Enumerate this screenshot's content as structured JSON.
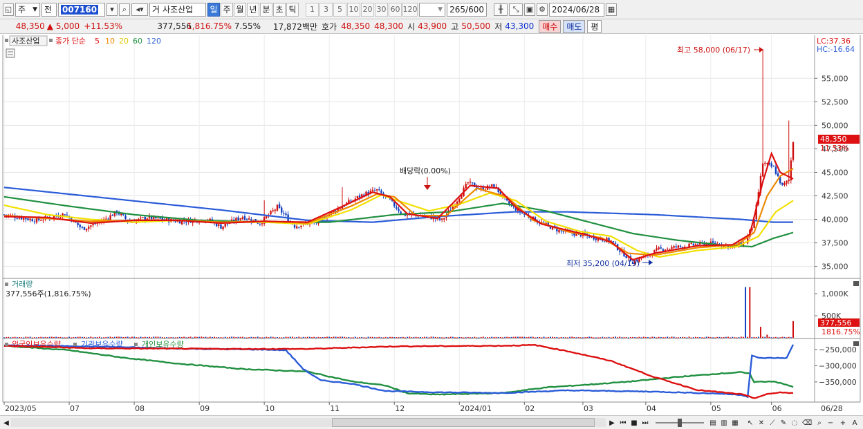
{
  "toolbar": {
    "market": "주",
    "prev_label": "전",
    "code": "007160",
    "name_prefix": "거",
    "stock_name": "사조산업",
    "periods": [
      "일",
      "주",
      "월",
      "년",
      "분",
      "초",
      "틱"
    ],
    "active_period": "일",
    "numbers": [
      "1",
      "3",
      "5",
      "10",
      "20",
      "30",
      "60",
      "120"
    ],
    "count_value": "265",
    "count_total": "/600",
    "date": "2024/06/28"
  },
  "quote": {
    "price": "48,350",
    "change_arrow": "▲",
    "change": "5,000",
    "change_pct": "+11.53%",
    "volume": "377,556",
    "volume_ratio": "1,816.75%",
    "turnover": "7.55%",
    "amount": "17,872백만",
    "hoga_label": "호가",
    "ask": "48,350",
    "bid": "48,300",
    "open_label": "시",
    "open": "43,900",
    "high_label": "고",
    "high": "50,500",
    "low_label": "저",
    "low": "43,300",
    "buy_label": "매수",
    "sell_label": "매도",
    "eval_label": "평"
  },
  "legend": {
    "stock_name": "사조산업",
    "ma_label": "종가 단순",
    "periods": [
      "5",
      "10",
      "20",
      "60",
      "120"
    ]
  },
  "lc_label": "LC:37.36",
  "hc_label": "HC:-16.64",
  "annotations": {
    "high": "최고 58,000 (06/17)",
    "low": "최저 35,200 (04/19)",
    "dividend": "배당락(0.00%)"
  },
  "price_badge": {
    "value": "48,350",
    "pct": "11.53%"
  },
  "volume_panel": {
    "title": "거래량",
    "value_text": "377,556주(1,816.75%)",
    "badge_value": "377,556",
    "badge_pct": "1816.75%"
  },
  "holdings_panel": {
    "legend": [
      "외국인보유수량",
      "기관보유수량",
      "개인보유수량"
    ]
  },
  "colors": {
    "up": "#d01010",
    "down": "#1040c0",
    "ma5": "#dd1111",
    "ma10": "#ee8800",
    "ma20": "#f2e000",
    "ma60": "#209040",
    "ma120": "#2a5cd8",
    "foreign": "#dd1111",
    "institution": "#2a5cd8",
    "individual": "#209040"
  },
  "chart_data": {
    "type": "candlestick",
    "price_axis": {
      "ticks": [
        55000,
        52500,
        50000,
        47500,
        45000,
        42500,
        40000,
        37500,
        35000
      ],
      "ylim": [
        33800,
        59500
      ]
    },
    "volume_axis": {
      "ticks": [
        1000000,
        500000
      ],
      "unit": "K",
      "ylim": [
        0,
        1300000
      ]
    },
    "holdings_axis": {
      "ticks": [
        -250000,
        -300000,
        -350000
      ],
      "ylim": [
        -410000,
        -220000
      ]
    },
    "x_ticks": [
      "2023/05",
      "07",
      "08",
      "09",
      "10",
      "11",
      "12",
      "2024/01",
      "02",
      "03",
      "04",
      "05",
      "06",
      "06/28"
    ],
    "price_key": [
      [
        0,
        40500
      ],
      [
        15,
        39900
      ],
      [
        28,
        40600
      ],
      [
        36,
        39000
      ],
      [
        45,
        39800
      ],
      [
        52,
        40800
      ],
      [
        58,
        39700
      ],
      [
        66,
        40200
      ],
      [
        80,
        39800
      ],
      [
        94,
        40000
      ],
      [
        100,
        39200
      ],
      [
        110,
        40300
      ],
      [
        118,
        39600
      ],
      [
        126,
        41300
      ],
      [
        134,
        39300
      ],
      [
        144,
        39700
      ],
      [
        150,
        40600
      ],
      [
        158,
        41700
      ],
      [
        166,
        42700
      ],
      [
        172,
        43100
      ],
      [
        178,
        42000
      ],
      [
        184,
        40500
      ],
      [
        194,
        40400
      ],
      [
        202,
        39900
      ],
      [
        208,
        41700
      ],
      [
        214,
        43900
      ],
      [
        220,
        43200
      ],
      [
        226,
        43600
      ],
      [
        232,
        41800
      ],
      [
        238,
        40800
      ],
      [
        246,
        39800
      ],
      [
        256,
        38800
      ],
      [
        268,
        38300
      ],
      [
        280,
        37700
      ],
      [
        284,
        36700
      ],
      [
        290,
        35500
      ],
      [
        296,
        36100
      ],
      [
        302,
        36800
      ],
      [
        312,
        37100
      ],
      [
        322,
        37400
      ],
      [
        330,
        37400
      ],
      [
        336,
        37100
      ],
      [
        342,
        37600
      ],
      [
        346,
        39800
      ],
      [
        350,
        46000
      ],
      [
        355,
        45500
      ],
      [
        359,
        43500
      ],
      [
        362,
        44200
      ],
      [
        364,
        48350
      ]
    ],
    "ma_key": {
      "ma5": [
        [
          0,
          40300
        ],
        [
          20,
          40200
        ],
        [
          40,
          39600
        ],
        [
          60,
          39900
        ],
        [
          80,
          39900
        ],
        [
          100,
          39600
        ],
        [
          120,
          39800
        ],
        [
          140,
          39700
        ],
        [
          160,
          41800
        ],
        [
          170,
          42900
        ],
        [
          178,
          42400
        ],
        [
          186,
          40600
        ],
        [
          200,
          40100
        ],
        [
          215,
          43600
        ],
        [
          228,
          43300
        ],
        [
          236,
          41300
        ],
        [
          248,
          39500
        ],
        [
          268,
          38400
        ],
        [
          280,
          37600
        ],
        [
          290,
          35700
        ],
        [
          300,
          36400
        ],
        [
          320,
          37200
        ],
        [
          336,
          37300
        ],
        [
          344,
          38400
        ],
        [
          350,
          44000
        ],
        [
          354,
          47000
        ],
        [
          358,
          45000
        ],
        [
          364,
          44300
        ]
      ],
      "ma10": [
        [
          0,
          40400
        ],
        [
          20,
          40100
        ],
        [
          40,
          39800
        ],
        [
          60,
          39900
        ],
        [
          80,
          39900
        ],
        [
          100,
          39700
        ],
        [
          120,
          39800
        ],
        [
          140,
          39600
        ],
        [
          160,
          41400
        ],
        [
          172,
          42700
        ],
        [
          180,
          42400
        ],
        [
          190,
          40400
        ],
        [
          204,
          40400
        ],
        [
          218,
          43300
        ],
        [
          232,
          42400
        ],
        [
          244,
          39900
        ],
        [
          260,
          38700
        ],
        [
          276,
          38000
        ],
        [
          288,
          36400
        ],
        [
          300,
          36200
        ],
        [
          320,
          37000
        ],
        [
          338,
          37300
        ],
        [
          346,
          38600
        ],
        [
          352,
          42500
        ],
        [
          358,
          44600
        ],
        [
          364,
          45400
        ]
      ],
      "ma20": [
        [
          0,
          41500
        ],
        [
          20,
          40500
        ],
        [
          40,
          40000
        ],
        [
          60,
          39700
        ],
        [
          80,
          39900
        ],
        [
          100,
          39700
        ],
        [
          120,
          39700
        ],
        [
          140,
          39500
        ],
        [
          160,
          41000
        ],
        [
          174,
          42600
        ],
        [
          184,
          41800
        ],
        [
          196,
          40900
        ],
        [
          210,
          41600
        ],
        [
          224,
          42800
        ],
        [
          236,
          42000
        ],
        [
          250,
          39800
        ],
        [
          266,
          38700
        ],
        [
          280,
          38200
        ],
        [
          292,
          36700
        ],
        [
          302,
          36000
        ],
        [
          320,
          36700
        ],
        [
          338,
          37100
        ],
        [
          348,
          38200
        ],
        [
          356,
          40800
        ],
        [
          364,
          42000
        ]
      ],
      "ma60": [
        [
          0,
          42400
        ],
        [
          30,
          41400
        ],
        [
          60,
          40500
        ],
        [
          90,
          39900
        ],
        [
          120,
          39700
        ],
        [
          150,
          39700
        ],
        [
          180,
          40500
        ],
        [
          205,
          40800
        ],
        [
          230,
          41700
        ],
        [
          250,
          40900
        ],
        [
          270,
          39700
        ],
        [
          290,
          38500
        ],
        [
          310,
          37800
        ],
        [
          330,
          37300
        ],
        [
          345,
          37100
        ],
        [
          355,
          38000
        ],
        [
          364,
          38600
        ]
      ],
      "ma120": [
        [
          0,
          43400
        ],
        [
          50,
          42200
        ],
        [
          100,
          41000
        ],
        [
          140,
          39900
        ],
        [
          170,
          39700
        ],
        [
          200,
          40300
        ],
        [
          235,
          40800
        ],
        [
          260,
          40800
        ],
        [
          300,
          40500
        ],
        [
          340,
          40000
        ],
        [
          355,
          39700
        ],
        [
          364,
          39700
        ]
      ]
    },
    "volume_spikes": [
      [
        342,
        1150000
      ],
      [
        344,
        1150000
      ],
      [
        349,
        250000
      ],
      [
        352,
        70000
      ],
      [
        364,
        377556
      ]
    ],
    "holdings": {
      "foreign": [
        [
          0,
          -238000
        ],
        [
          40,
          -246000
        ],
        [
          80,
          -247000
        ],
        [
          100,
          -248000
        ],
        [
          140,
          -248000
        ],
        [
          180,
          -240000
        ],
        [
          230,
          -238000
        ],
        [
          245,
          -236000
        ],
        [
          260,
          -255000
        ],
        [
          280,
          -285000
        ],
        [
          300,
          -335000
        ],
        [
          320,
          -375000
        ],
        [
          340,
          -388000
        ],
        [
          346,
          -400000
        ],
        [
          352,
          -388000
        ],
        [
          358,
          -382000
        ],
        [
          364,
          -385000
        ]
      ],
      "institution": [
        [
          0,
          -237000
        ],
        [
          40,
          -240000
        ],
        [
          80,
          -247000
        ],
        [
          120,
          -250000
        ],
        [
          130,
          -252000
        ],
        [
          138,
          -310000
        ],
        [
          146,
          -345000
        ],
        [
          160,
          -355000
        ],
        [
          176,
          -378000
        ],
        [
          200,
          -382000
        ],
        [
          230,
          -384000
        ],
        [
          260,
          -376000
        ],
        [
          300,
          -380000
        ],
        [
          330,
          -386000
        ],
        [
          340,
          -390000
        ],
        [
          343,
          -395000
        ],
        [
          345,
          -268000
        ],
        [
          348,
          -276000
        ],
        [
          358,
          -276000
        ],
        [
          361,
          -276000
        ],
        [
          364,
          -235000
        ]
      ],
      "individual": [
        [
          0,
          -238000
        ],
        [
          30,
          -252000
        ],
        [
          55,
          -275000
        ],
        [
          80,
          -293000
        ],
        [
          110,
          -310000
        ],
        [
          140,
          -318000
        ],
        [
          160,
          -348000
        ],
        [
          176,
          -361000
        ],
        [
          186,
          -385000
        ],
        [
          200,
          -389000
        ],
        [
          230,
          -384000
        ],
        [
          250,
          -367000
        ],
        [
          270,
          -358000
        ],
        [
          290,
          -348000
        ],
        [
          310,
          -335000
        ],
        [
          330,
          -324000
        ],
        [
          340,
          -320000
        ],
        [
          344,
          -325000
        ],
        [
          346,
          -350000
        ],
        [
          355,
          -348000
        ],
        [
          364,
          -365000
        ]
      ]
    }
  }
}
